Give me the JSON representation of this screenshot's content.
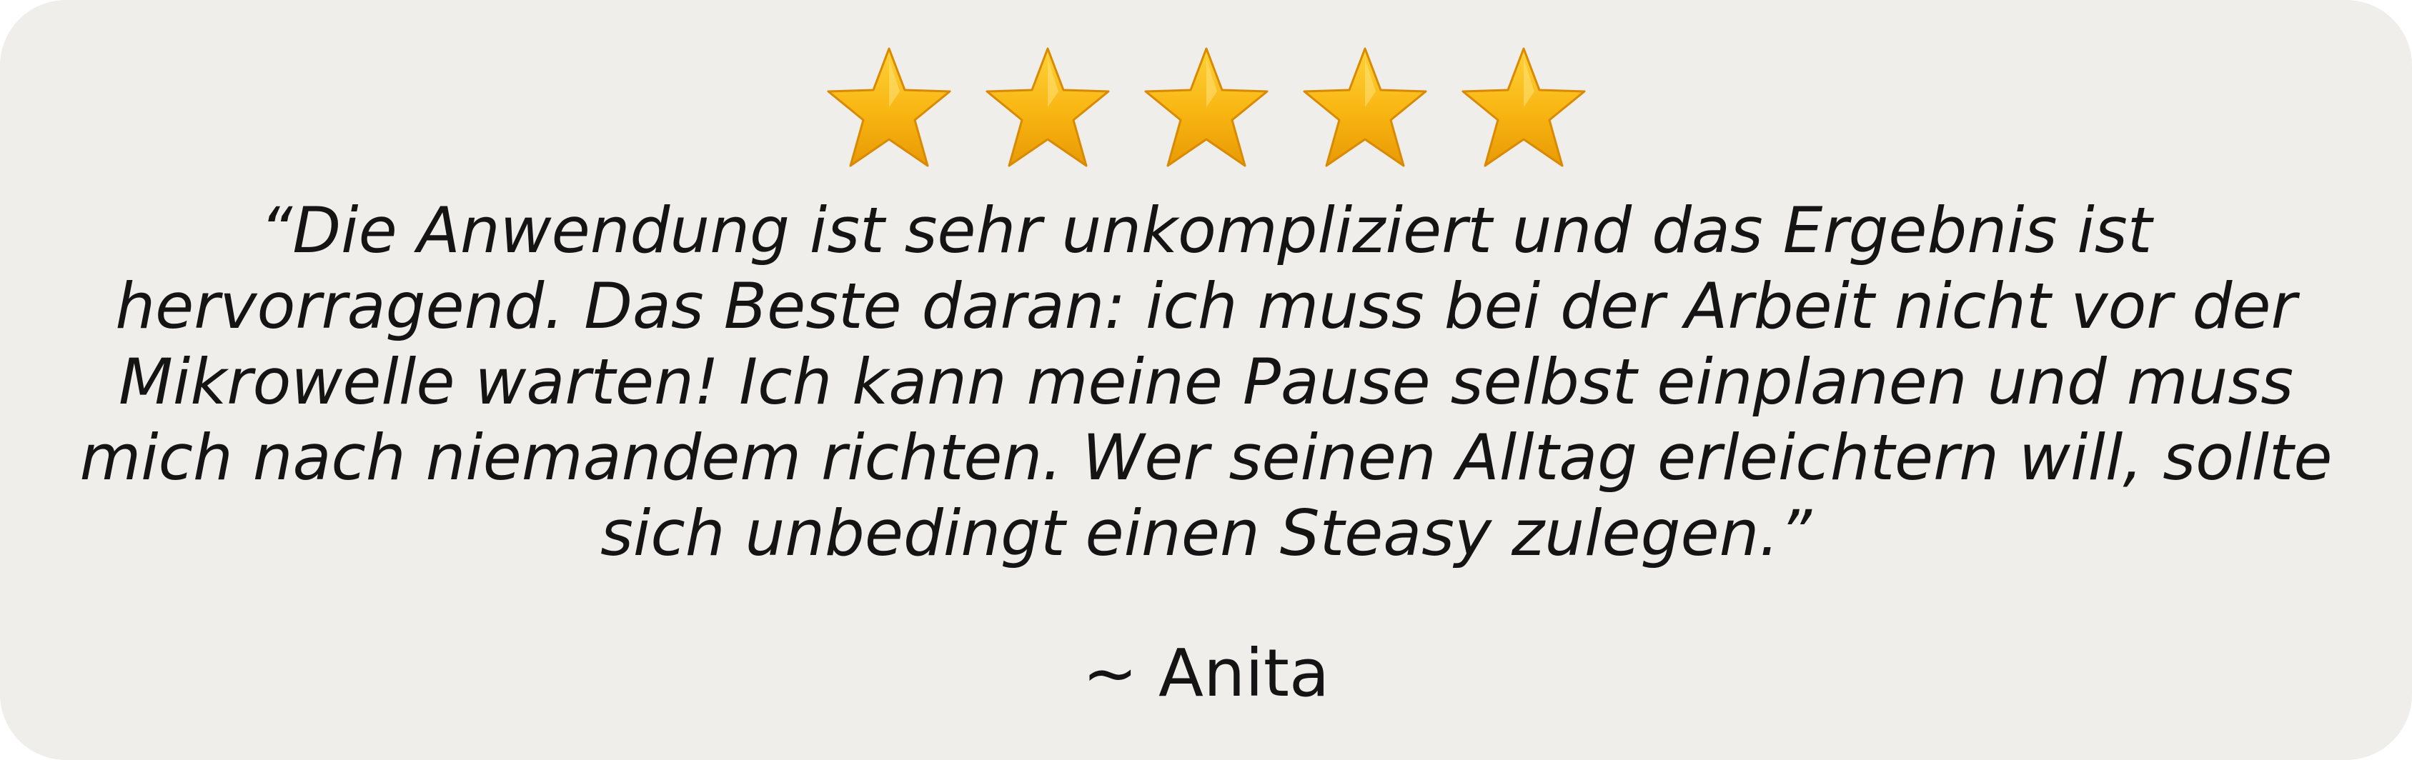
{
  "rating": {
    "value": 5,
    "max": 5,
    "star_color": "#f6ae0f",
    "icon": "star-icon"
  },
  "review": {
    "quote": "“Die Anwendung ist sehr unkompliziert und das Ergebnis ist hervorragend. Das Beste daran: ich muss bei der Arbeit nicht vor der Mikrowelle warten! Ich kann meine Pause selbst einplanen und muss mich nach niemandem richten. Wer seinen Alltag erleichtern will, sollte sich unbedingt einen Steasy zulegen.”",
    "author": "~ Anita"
  },
  "colors": {
    "card_background": "#efeeeb",
    "text": "#141414"
  }
}
